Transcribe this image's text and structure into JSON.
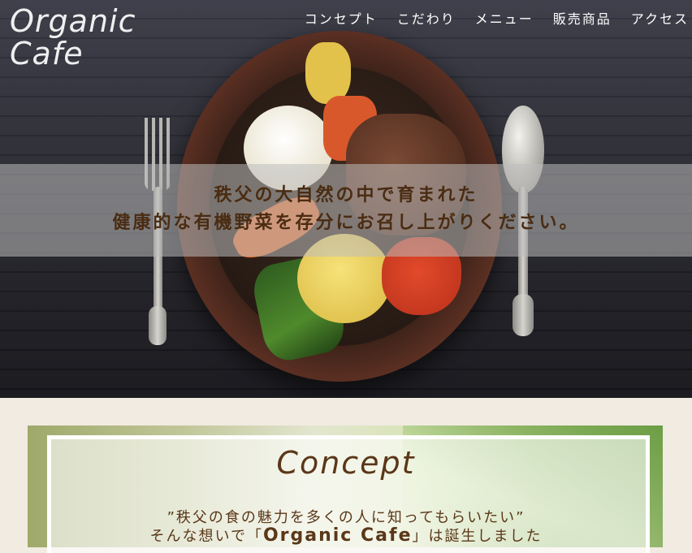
{
  "brand": {
    "line1": "Organic",
    "line2": "Cafe"
  },
  "nav": {
    "items": [
      "コンセプト",
      "こだわり",
      "メニュー",
      "販売商品",
      "アクセス"
    ]
  },
  "hero": {
    "line1": "秩父の大自然の中で育まれた",
    "line2": "健康的な有機野菜を存分にお召し上がりください。"
  },
  "concept": {
    "title": "Concept",
    "line1": "”秩父の食の魅力を多くの人に知ってもらいたい”",
    "line2_prefix": "そんな想いで「",
    "line2_name": "Organic Cafe",
    "line2_suffix": "」は誕生しました"
  },
  "colors": {
    "accent_text": "#5a3718",
    "banner_text": "#4a2c12"
  }
}
